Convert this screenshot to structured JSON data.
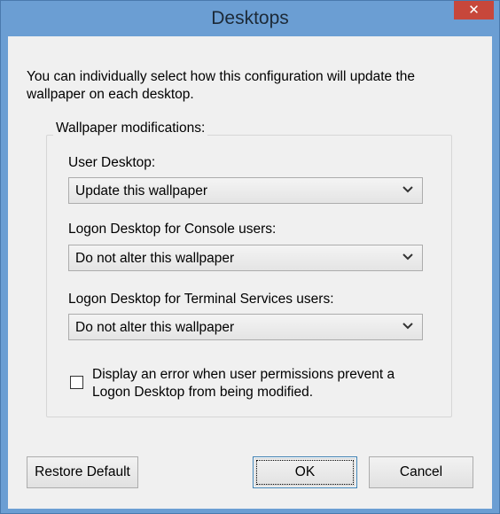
{
  "window": {
    "title": "Desktops",
    "close_label": "✕"
  },
  "dialog": {
    "intro_text": "You can individually select how this configuration will update the wallpaper on each desktop.",
    "group_title": "Wallpaper modifications:",
    "fields": [
      {
        "label": "User Desktop:",
        "value": "Update this wallpaper"
      },
      {
        "label": "Logon Desktop for Console users:",
        "value": "Do not alter this wallpaper"
      },
      {
        "label": "Logon Desktop for Terminal Services users:",
        "value": "Do not alter this wallpaper"
      }
    ],
    "checkbox": {
      "label": "Display an error when user permissions prevent a Logon Desktop from being modified.",
      "checked": false
    }
  },
  "buttons": {
    "restore_default": "Restore Default",
    "ok": "OK",
    "cancel": "Cancel"
  },
  "colors": {
    "frame": "#6b9ed3",
    "client": "#f0f0f0",
    "close_button": "#c7473b"
  },
  "icons": {
    "close": "close-icon",
    "dropdown": "chevron-down-icon"
  }
}
